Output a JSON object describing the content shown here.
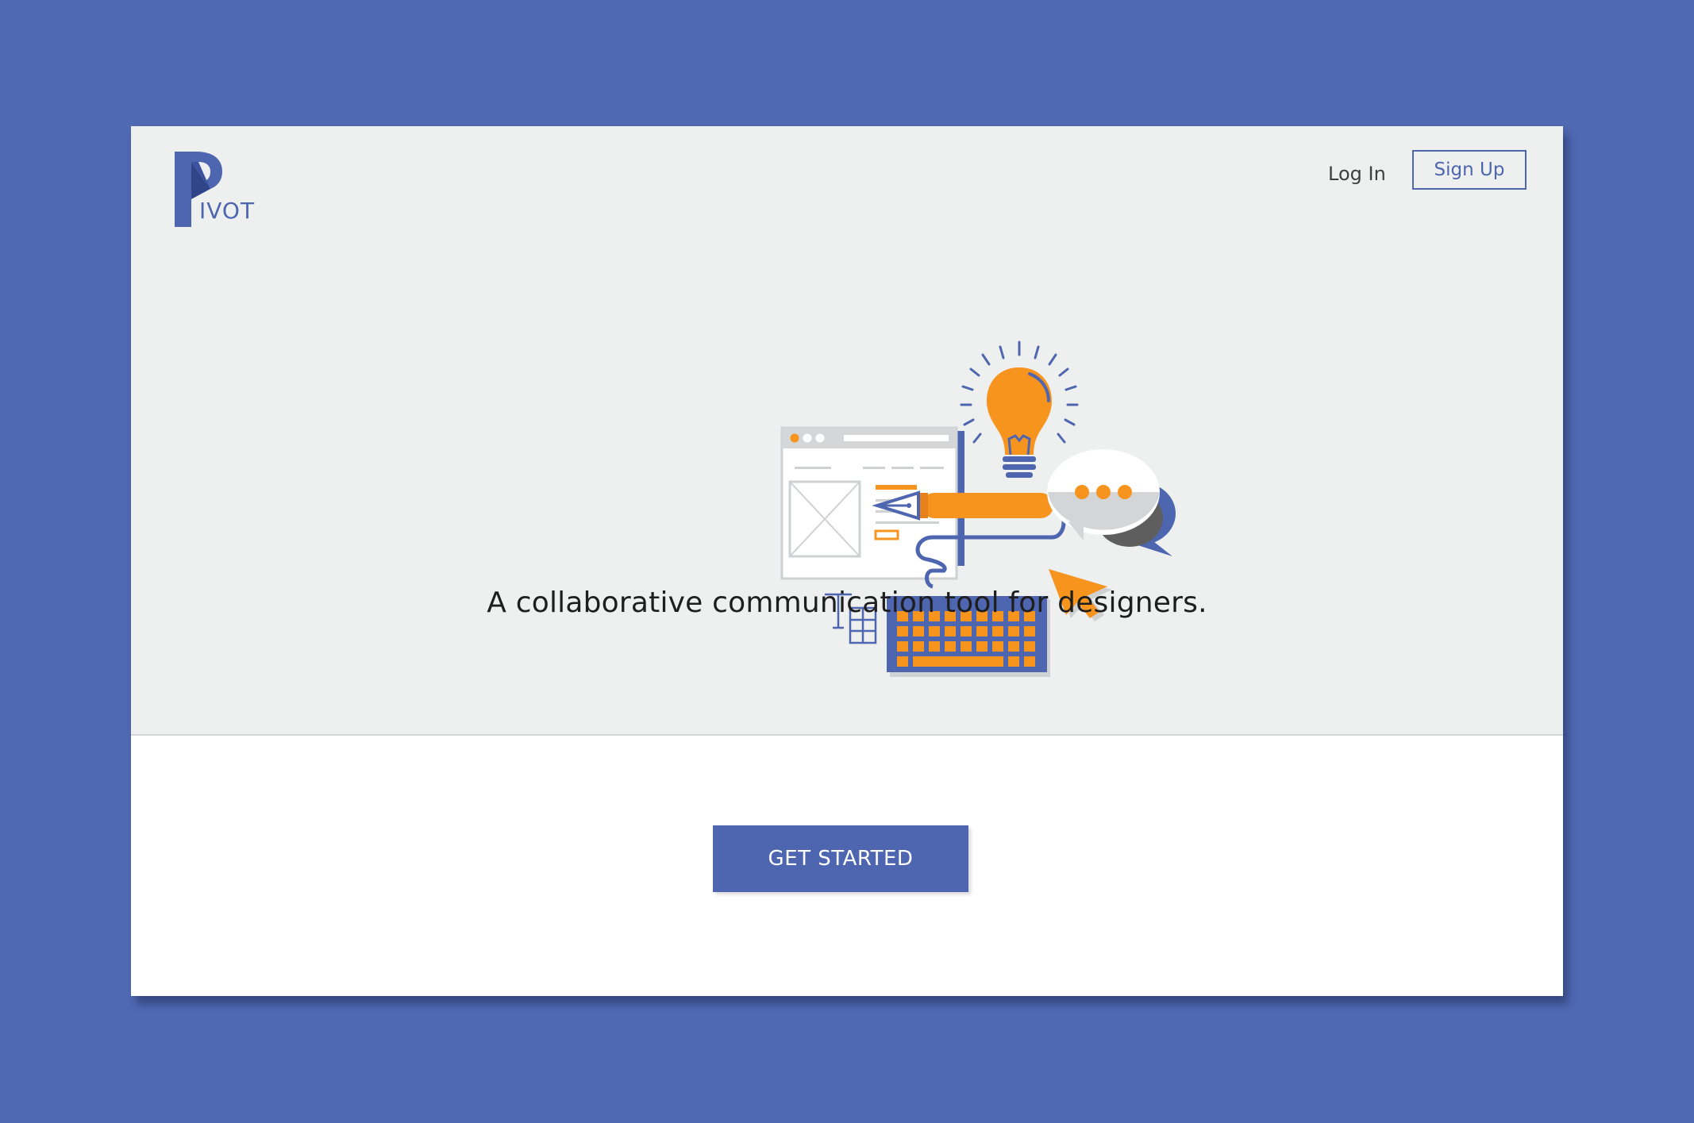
{
  "brand": {
    "logo_letter": "P",
    "logo_text": "IVOT"
  },
  "nav": {
    "login_label": "Log In",
    "signup_label": "Sign Up"
  },
  "hero": {
    "tagline": "A collaborative communication tool for designers."
  },
  "cta": {
    "label": "GET STARTED"
  },
  "colors": {
    "brand_blue": "#4e66b0",
    "background": "#5069b3",
    "hero_bg": "#eeefef",
    "accent_orange": "#f7941e"
  },
  "illustration": {
    "icons": [
      "browser-window-icon",
      "lightbulb-icon",
      "pen-icon",
      "chat-bubbles-icon",
      "cursor-arrow-icon",
      "keyboard-icon",
      "text-table-icon"
    ]
  }
}
